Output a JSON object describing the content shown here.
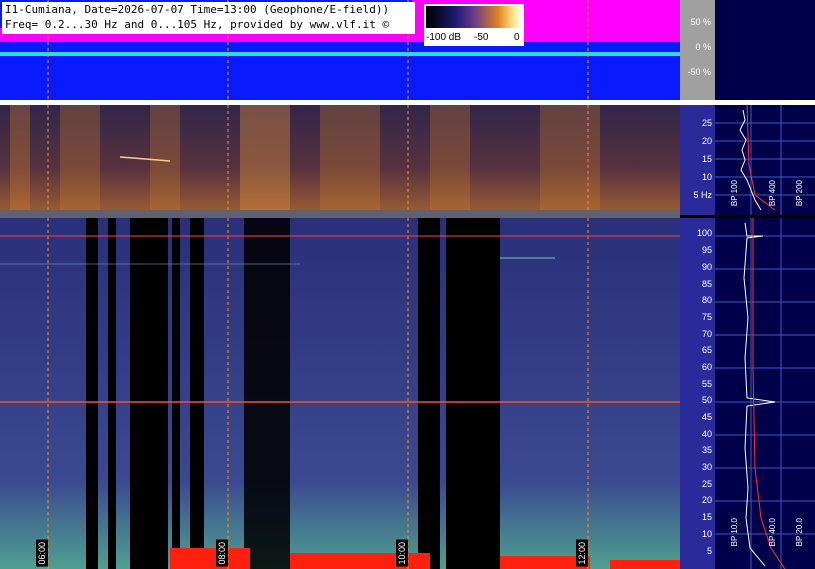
{
  "header": {
    "line1": "I1-Cumiana, Date=2026-07-07 Time=13:00 (Geophone/E-field))",
    "line2": "Freq= 0.2...30 Hz and 0...105 Hz, provided by www.vlf.it ©"
  },
  "colorbar": {
    "min_label": "-100 dB",
    "mid_label": "-50",
    "max_label": "0"
  },
  "percent_scale": [
    "50 %",
    "0 %",
    "-50 %"
  ],
  "low_axis_ticks": [
    "25",
    "20",
    "15",
    "10",
    "5 Hz"
  ],
  "high_axis_ticks": [
    "100",
    "95",
    "90",
    "85",
    "80",
    "75",
    "70",
    "65",
    "60",
    "55",
    "50",
    "45",
    "40",
    "35",
    "30",
    "25",
    "20",
    "15",
    "10",
    "5"
  ],
  "time_labels": [
    "06:00",
    "08:00",
    "10:00",
    "12:00"
  ],
  "side_labels_low": [
    "BP 100",
    "BP 400",
    "BP 200"
  ],
  "side_labels_high": [
    "BP 10.0",
    "BP 40.0",
    "BP 20.0"
  ],
  "colors": {
    "background_blue": "#0a1aff",
    "trace_magenta": "#ff00ff",
    "trace_cyan": "#20e0e0",
    "axis_blue": "#2a2a9a",
    "grid_orange": "#ff9020",
    "hot_red": "#ff2010"
  }
}
